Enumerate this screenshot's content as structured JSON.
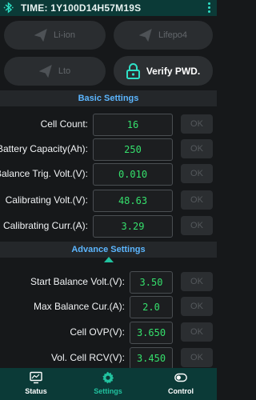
{
  "header": {
    "title": "TIME: 1Y100D14H57M19S"
  },
  "modes": {
    "liion": "Li-ion",
    "lifepo4": "Lifepo4",
    "lto": "Lto",
    "verify": "Verify PWD."
  },
  "sections": {
    "basic": "Basic Settings",
    "advance": "Advance Settings"
  },
  "basic_rows": [
    {
      "label": "Cell Count:",
      "value": "16",
      "ok": "OK"
    },
    {
      "label": "Battery Capacity(Ah):",
      "value": "250",
      "ok": "OK"
    },
    {
      "label": "Balance Trig. Volt.(V):",
      "value": "0.010",
      "ok": "OK"
    },
    {
      "label": "Calibrating Volt.(V):",
      "value": "48.63",
      "ok": "OK"
    },
    {
      "label": "Calibrating Curr.(A):",
      "value": "3.29",
      "ok": "OK"
    }
  ],
  "advance_rows": [
    {
      "label": "Start Balance Volt.(V):",
      "value": "3.50",
      "ok": "OK"
    },
    {
      "label": "Max Balance Cur.(A):",
      "value": "2.0",
      "ok": "OK"
    },
    {
      "label": "Cell OVP(V):",
      "value": "3.650",
      "ok": "OK"
    },
    {
      "label": "Vol. Cell RCV(V):",
      "value": "3.450",
      "ok": "OK"
    }
  ],
  "nav": {
    "status": "Status",
    "settings": "Settings",
    "control": "Control",
    "active": "Settings"
  },
  "colors": {
    "accent": "#21c29f",
    "value_green": "#35e06c",
    "section_blue": "#5cb6ff",
    "bar": "#0b3a37"
  }
}
